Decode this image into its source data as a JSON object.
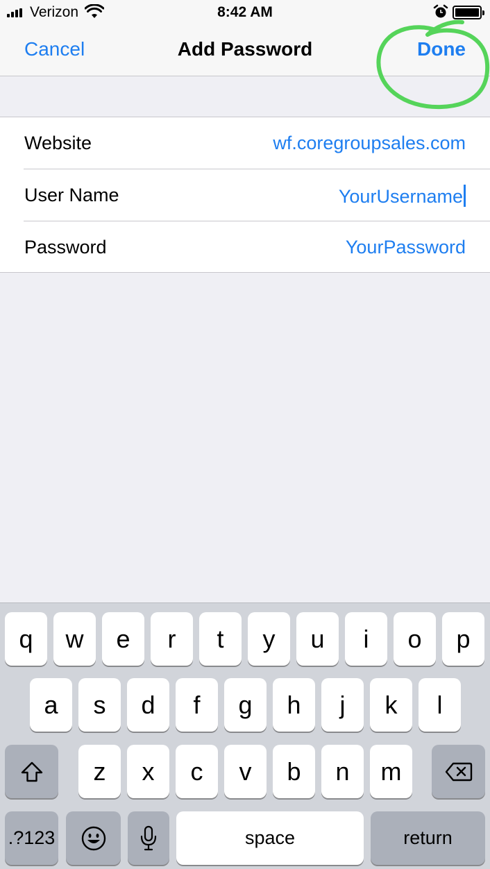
{
  "status_bar": {
    "carrier": "Verizon",
    "time": "8:42 AM",
    "icons": [
      "signal-icon",
      "wifi-icon",
      "alarm-icon",
      "battery-icon"
    ]
  },
  "nav": {
    "cancel": "Cancel",
    "title": "Add Password",
    "done": "Done"
  },
  "form": {
    "rows": [
      {
        "label": "Website",
        "value": "wf.coregroupsales.com"
      },
      {
        "label": "User Name",
        "value": "YourUsername"
      },
      {
        "label": "Password",
        "value": "YourPassword"
      }
    ]
  },
  "keyboard": {
    "row1": [
      "q",
      "w",
      "e",
      "r",
      "t",
      "y",
      "u",
      "i",
      "o",
      "p"
    ],
    "row2": [
      "a",
      "s",
      "d",
      "f",
      "g",
      "h",
      "j",
      "k",
      "l"
    ],
    "row3": [
      "z",
      "x",
      "c",
      "v",
      "b",
      "n",
      "m"
    ],
    "numbers": ".?123",
    "space": "space",
    "return": "return",
    "icons": [
      "shift-icon",
      "backspace-icon",
      "emoji-icon",
      "microphone-icon"
    ]
  },
  "colors": {
    "accent": "#1e7ef0",
    "annotation": "#55d45a",
    "background": "#efeff4",
    "keyboard": "#d1d4da"
  }
}
